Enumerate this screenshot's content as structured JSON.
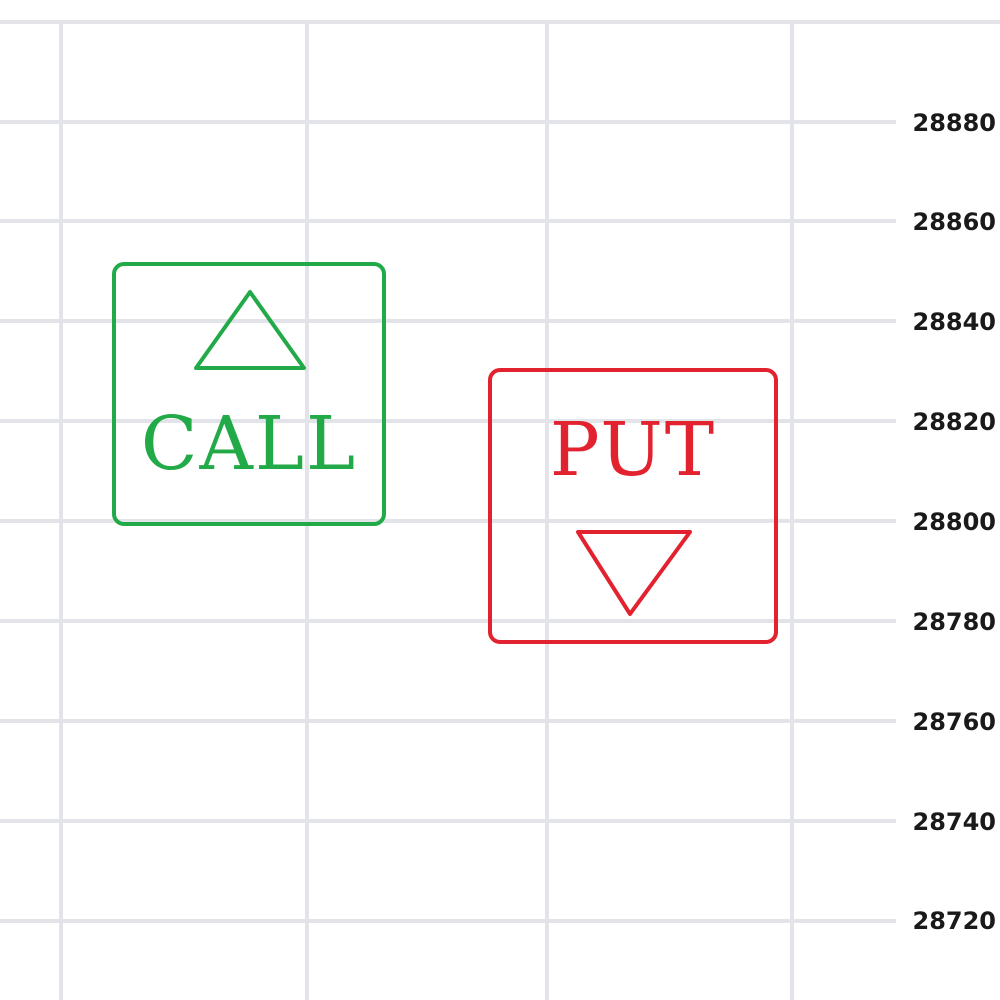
{
  "price_axis": {
    "labels": [
      "28880",
      "28860",
      "28840",
      "28820",
      "28800",
      "28780",
      "28760",
      "28740",
      "28720"
    ]
  },
  "call_button": {
    "label": "CALL",
    "icon": "up-triangle-icon"
  },
  "put_button": {
    "label": "PUT",
    "icon": "down-triangle-icon"
  },
  "colors": {
    "grid": "#e3e3ea",
    "call": "#22aa48",
    "put": "#e2232f",
    "label_text": "#1a1a1a",
    "background": "#ffffff"
  }
}
